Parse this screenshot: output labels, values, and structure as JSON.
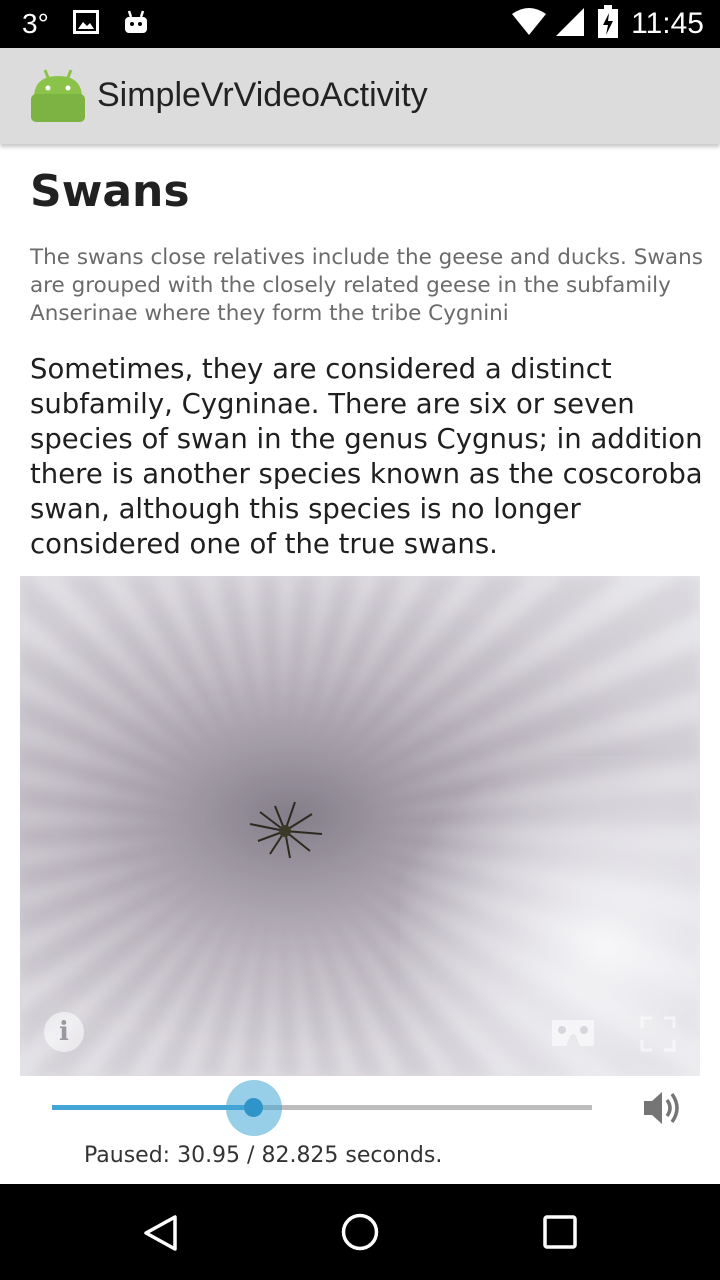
{
  "status_bar": {
    "temperature": "3°",
    "time": "11:45",
    "icons": [
      "image-icon",
      "android-icon",
      "wifi-icon",
      "cell-signal-icon",
      "battery-charging-icon"
    ]
  },
  "app_bar": {
    "title": "SimpleVrVideoActivity",
    "icon": "android-launcher-icon"
  },
  "article": {
    "heading": "Swans",
    "summary": "The swans close relatives include the geese and ducks. Swans are grouped with the closely related geese in the subfamily Anserinae where they form the tribe Cygnini",
    "body": "Sometimes, they are considered a distinct subfamily, Cygninae. There are six or seven species of swan in the genus Cygnus; in addition there is another species known as the coscoroba swan, although this species is no longer considered one of the true swans."
  },
  "video_player": {
    "info_label": "i",
    "controls": [
      "info-icon",
      "cardboard-icon",
      "fullscreen-icon"
    ]
  },
  "playback": {
    "position_seconds": 30.95,
    "duration_seconds": 82.825,
    "status_text": "Paused: 30.95 / 82.825 seconds.",
    "volume_icon": "volume-icon"
  },
  "colors": {
    "seek_accent": "#42a5d5",
    "app_bar": "#dcdcdc"
  },
  "nav_bar": {
    "buttons": [
      "back-icon",
      "home-icon",
      "recents-icon"
    ]
  }
}
